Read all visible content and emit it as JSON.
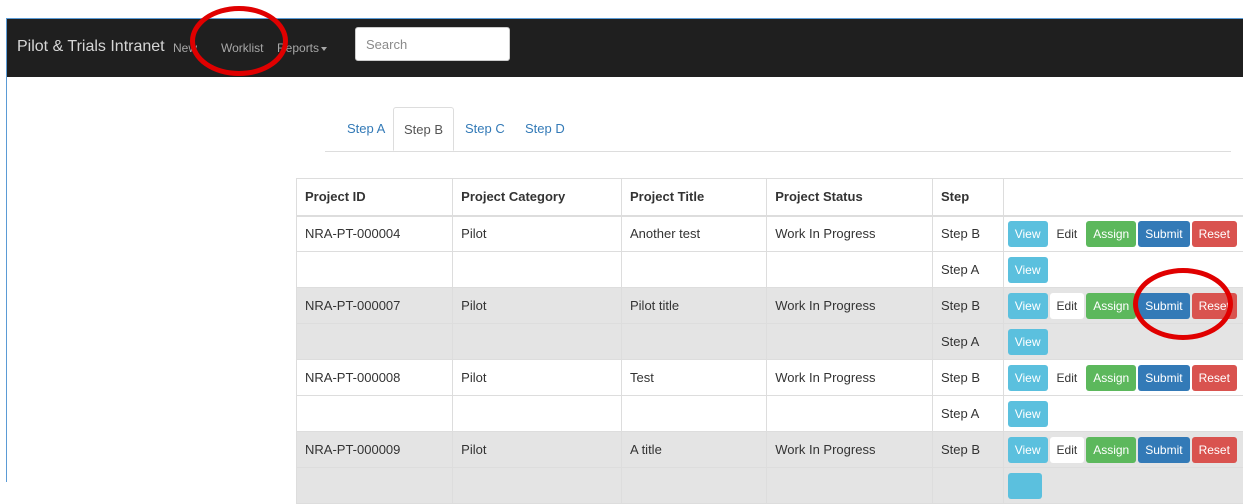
{
  "navbar": {
    "brand": "Pilot & Trials Intranet",
    "links": {
      "new": "New",
      "worklist": "Worklist",
      "reports": "Reports"
    },
    "search_placeholder": "Search"
  },
  "tabs": [
    "Step A",
    "Step B",
    "Step C",
    "Step D"
  ],
  "active_tab": "Step B",
  "table": {
    "headers": [
      "Project ID",
      "Project Category",
      "Project Title",
      "Project Status",
      "Step",
      ""
    ],
    "rows": [
      {
        "id": "NRA-PT-000004",
        "category": "Pilot",
        "title": "Another test",
        "status": "Work In Progress",
        "step": "Step B"
      },
      {
        "id": "",
        "category": "",
        "title": "",
        "status": "",
        "step": "Step A"
      },
      {
        "id": "NRA-PT-000007",
        "category": "Pilot",
        "title": "Pilot title",
        "status": "Work In Progress",
        "step": "Step B"
      },
      {
        "id": "",
        "category": "",
        "title": "",
        "status": "",
        "step": "Step A"
      },
      {
        "id": "NRA-PT-000008",
        "category": "Pilot",
        "title": "Test",
        "status": "Work In Progress",
        "step": "Step B"
      },
      {
        "id": "",
        "category": "",
        "title": "",
        "status": "",
        "step": "Step A"
      },
      {
        "id": "NRA-PT-000009",
        "category": "Pilot",
        "title": "A title",
        "status": "Work In Progress",
        "step": "Step B"
      }
    ],
    "actions": {
      "view": "View",
      "edit": "Edit",
      "assign": "Assign",
      "submit": "Submit",
      "reset": "Reset"
    }
  },
  "colors": {
    "navbar": "#1f1f1f",
    "link": "#337ab7",
    "view": "#5bc0de",
    "assign": "#5cb85c",
    "submit": "#337ab7",
    "reset": "#d9534f",
    "row_shade": "#e4e4e4",
    "annotation": "#e00000"
  }
}
